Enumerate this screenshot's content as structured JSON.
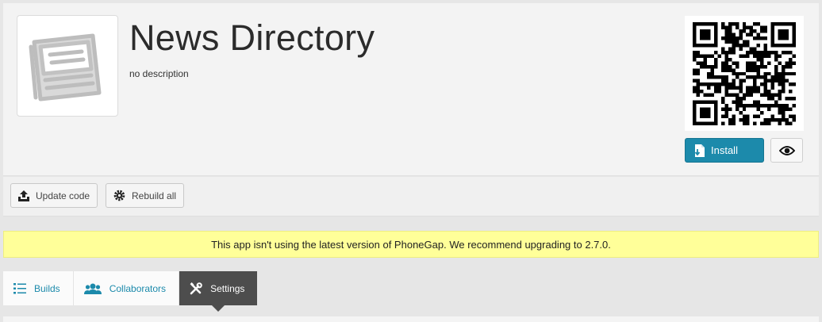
{
  "app": {
    "title": "News Directory",
    "description": "no description",
    "icon": "newspaper-icon"
  },
  "actions": {
    "install_label": "Install",
    "install_icon": "install-icon",
    "preview_icon": "eye-icon",
    "update_code_label": "Update code",
    "rebuild_all_label": "Rebuild all"
  },
  "notice": {
    "text": "This app isn't using the latest version of PhoneGap. We recommend upgrading to 2.7.0."
  },
  "tabs": [
    {
      "label": "Builds",
      "icon": "list-icon",
      "active": false
    },
    {
      "label": "Collaborators",
      "icon": "users-icon",
      "active": false
    },
    {
      "label": "Settings",
      "icon": "tools-icon",
      "active": true
    }
  ],
  "colors": {
    "accent": "#1c8aab",
    "notice_bg": "#ffff99",
    "active_tab": "#4d4d4d"
  }
}
